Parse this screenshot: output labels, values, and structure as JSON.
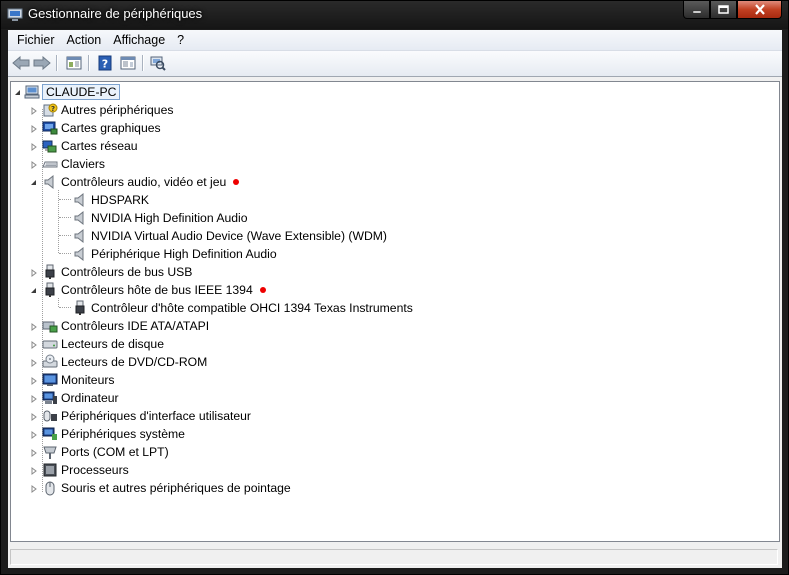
{
  "window": {
    "title": "Gestionnaire de périphériques"
  },
  "menubar": {
    "items": [
      "Fichier",
      "Action",
      "Affichage",
      "?"
    ]
  },
  "toolbar": {
    "buttons": [
      "back-icon",
      "forward-icon",
      "show-hide-console-tree-icon",
      "help-icon",
      "properties-icon",
      "scan-hardware-icon"
    ]
  },
  "tree": {
    "root": "CLAUDE-PC",
    "categories": [
      {
        "label": "Autres périphériques",
        "icon": "unknown-device-icon",
        "expanded": false
      },
      {
        "label": "Cartes graphiques",
        "icon": "display-adapter-icon",
        "expanded": false
      },
      {
        "label": "Cartes réseau",
        "icon": "network-adapter-icon",
        "expanded": false
      },
      {
        "label": "Claviers",
        "icon": "keyboard-icon",
        "expanded": false
      },
      {
        "label": "Contrôleurs audio, vidéo et jeu",
        "icon": "speaker-icon",
        "expanded": true,
        "marked": true,
        "children": [
          "HDSPARK",
          "NVIDIA High Definition Audio",
          "NVIDIA Virtual Audio Device (Wave Extensible) (WDM)",
          "Périphérique High Definition Audio"
        ]
      },
      {
        "label": "Contrôleurs de bus USB",
        "icon": "usb-icon",
        "expanded": false
      },
      {
        "label": "Contrôleurs hôte de bus IEEE 1394",
        "icon": "firewire-icon",
        "expanded": true,
        "marked": true,
        "children": [
          "Contrôleur d'hôte compatible OHCI 1394 Texas Instruments"
        ]
      },
      {
        "label": "Contrôleurs IDE ATA/ATAPI",
        "icon": "ide-controller-icon",
        "expanded": false
      },
      {
        "label": "Lecteurs de disque",
        "icon": "disk-drive-icon",
        "expanded": false
      },
      {
        "label": "Lecteurs de DVD/CD-ROM",
        "icon": "dvd-drive-icon",
        "expanded": false
      },
      {
        "label": "Moniteurs",
        "icon": "monitor-icon",
        "expanded": false
      },
      {
        "label": "Ordinateur",
        "icon": "computer-icon",
        "expanded": false
      },
      {
        "label": "Périphériques d'interface utilisateur",
        "icon": "hid-icon",
        "expanded": false
      },
      {
        "label": "Périphériques système",
        "icon": "system-device-icon",
        "expanded": false
      },
      {
        "label": "Ports (COM et LPT)",
        "icon": "port-icon",
        "expanded": false
      },
      {
        "label": "Processeurs",
        "icon": "processor-icon",
        "expanded": false
      },
      {
        "label": "Souris et autres périphériques de pointage",
        "icon": "mouse-icon",
        "expanded": false
      }
    ]
  },
  "status": {
    "text": ""
  },
  "colors": {
    "marker": "#e00000",
    "selection_border": "#7da2ce",
    "selection_fill": "#eaf2fb"
  }
}
